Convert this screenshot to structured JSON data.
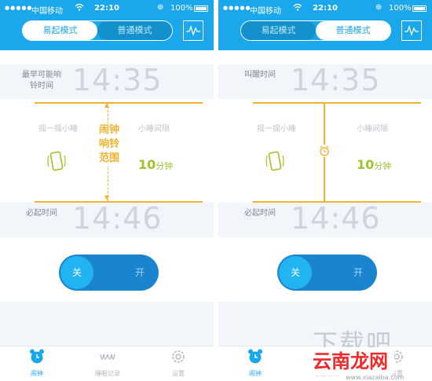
{
  "colors": {
    "accent": "#1aa7ec",
    "orange": "#f2b233",
    "green": "#9cc32a",
    "rowBg": "#f2f6fb"
  },
  "screens": [
    {
      "status": {
        "carrier": "中国移动",
        "time": "22:10",
        "battery": "100%"
      },
      "tabs": {
        "first": "易起模式",
        "second": "普通模式",
        "active": "易起模式"
      },
      "top_row": {
        "label": "最早可能响铃时间",
        "time": "14:35"
      },
      "bottom_row": {
        "label": "必起时间",
        "time": "14:46"
      },
      "range_label": "闹钟响铃范围",
      "shake": {
        "label": "摇一摇小睡"
      },
      "nap": {
        "label": "小睡间隔",
        "value": "10",
        "unit": "分钟"
      },
      "toggle": {
        "off": "关",
        "on": "开"
      },
      "tabbar": {
        "alarm": "闹钟",
        "sleep": "睡眠记录",
        "settings": "设置"
      }
    },
    {
      "status": {
        "carrier": "中国移动",
        "time": "22:10",
        "battery": "100%"
      },
      "tabs": {
        "first": "易起模式",
        "second": "普通模式",
        "active": "普通模式"
      },
      "top_row": {
        "label": "叫醒时间",
        "time": "14:35"
      },
      "bottom_row": {
        "label": "必起时间",
        "time": "14:46"
      },
      "shake": {
        "label": "摇一摇小睡"
      },
      "nap": {
        "label": "小睡间隔",
        "value": "10",
        "unit": "分钟"
      },
      "toggle": {
        "off": "关",
        "on": "开"
      },
      "tabbar": {
        "alarm": "闹钟",
        "sleep": "睡眠记录",
        "settings": "设置"
      }
    }
  ],
  "watermark": {
    "big": "下载吧",
    "badge": "云南龙网",
    "url": "www.xiazaiba.com"
  }
}
